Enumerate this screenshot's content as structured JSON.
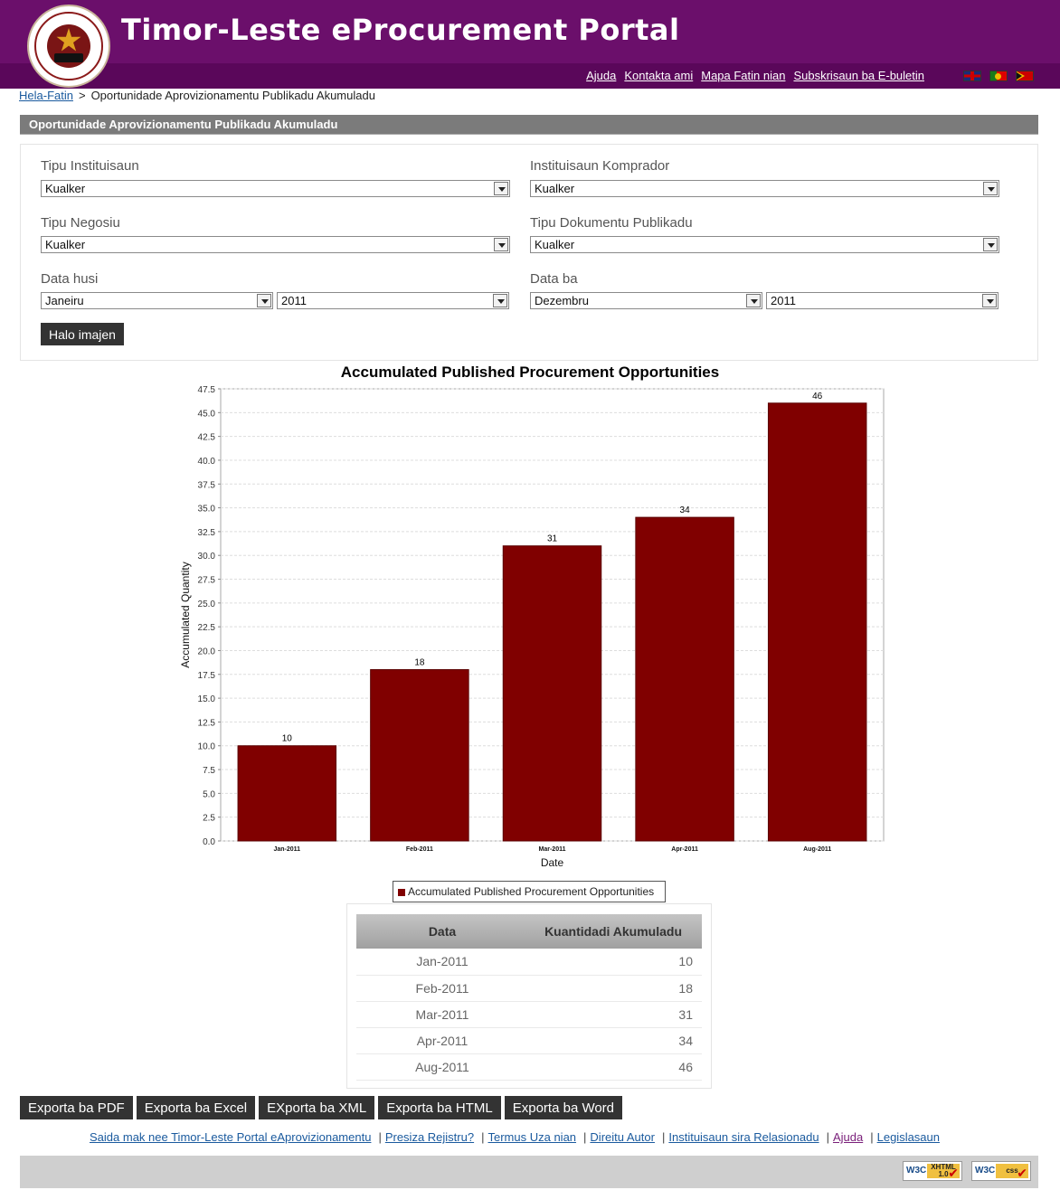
{
  "header": {
    "title": "Timor-Leste eProcurement Portal",
    "links": [
      "Ajuda",
      "Kontakta ami",
      "Mapa Fatin nian",
      "Subskrisaun ba E-buletin"
    ],
    "flags": [
      "uk-flag-icon",
      "portugal-flag-icon",
      "timor-flag-icon"
    ]
  },
  "breadcrumb": {
    "home": "Hela-Fatin",
    "separator": ">",
    "current": "Oportunidade Aprovizionamentu Publikadu Akumuladu"
  },
  "section": {
    "title": "Oportunidade Aprovizionamentu Publikadu Akumuladu"
  },
  "filters": {
    "tipu_instituisaun": {
      "label": "Tipu Instituisaun",
      "value": "Kualker"
    },
    "instituisaun_komprador": {
      "label": "Instituisaun Komprador",
      "value": "Kualker"
    },
    "tipu_negosiu": {
      "label": "Tipu Negosiu",
      "value": "Kualker"
    },
    "tipu_dokumentu": {
      "label": "Tipu Dokumentu Publikadu",
      "value": "Kualker"
    },
    "data_husi": {
      "label": "Data husi",
      "month": "Janeiru",
      "year": "2011"
    },
    "data_ba": {
      "label": "Data ba",
      "month": "Dezembru",
      "year": "2011"
    },
    "submit": "Halo imajen"
  },
  "chart_data": {
    "type": "bar",
    "title": "Accumulated Published Procurement Opportunities",
    "xlabel": "Date",
    "ylabel": "Accumulated Quantity",
    "categories": [
      "Jan-2011",
      "Feb-2011",
      "Mar-2011",
      "Apr-2011",
      "Aug-2011"
    ],
    "series": [
      {
        "name": "Accumulated Published Procurement Opportunities",
        "values": [
          10,
          18,
          31,
          34,
          46
        ]
      }
    ],
    "ylim": [
      0,
      47.5
    ],
    "yticks": [
      "0.0",
      "2.5",
      "5.0",
      "7.5",
      "10.0",
      "12.5",
      "15.0",
      "17.5",
      "20.0",
      "22.5",
      "25.0",
      "27.5",
      "30.0",
      "32.5",
      "35.0",
      "37.5",
      "40.0",
      "42.5",
      "45.0",
      "47.5"
    ],
    "grid": true,
    "legend": "bottom",
    "color": "#800000"
  },
  "table": {
    "headers": [
      "Data",
      "Kuantidadi Akumuladu"
    ],
    "rows": [
      [
        "Jan-2011",
        "10"
      ],
      [
        "Feb-2011",
        "18"
      ],
      [
        "Mar-2011",
        "31"
      ],
      [
        "Apr-2011",
        "34"
      ],
      [
        "Aug-2011",
        "46"
      ]
    ]
  },
  "exports": [
    "Exporta ba PDF",
    "Exporta ba Excel",
    "EXporta ba XML",
    "Exporta ba HTML",
    "Exporta ba Word"
  ],
  "footer": {
    "links": [
      "Saida mak nee Timor-Leste Portal eAprovizionamentu",
      "Presiza Rejistru?",
      "Termus Uza nian",
      "Direitu Autor",
      "Instituisaun sira Relasionadu",
      "Ajuda",
      "Legislasaun"
    ],
    "badges": [
      {
        "w3": "W3C",
        "label": "XHTML 1.0"
      },
      {
        "w3": "W3C",
        "label": "css"
      }
    ]
  }
}
